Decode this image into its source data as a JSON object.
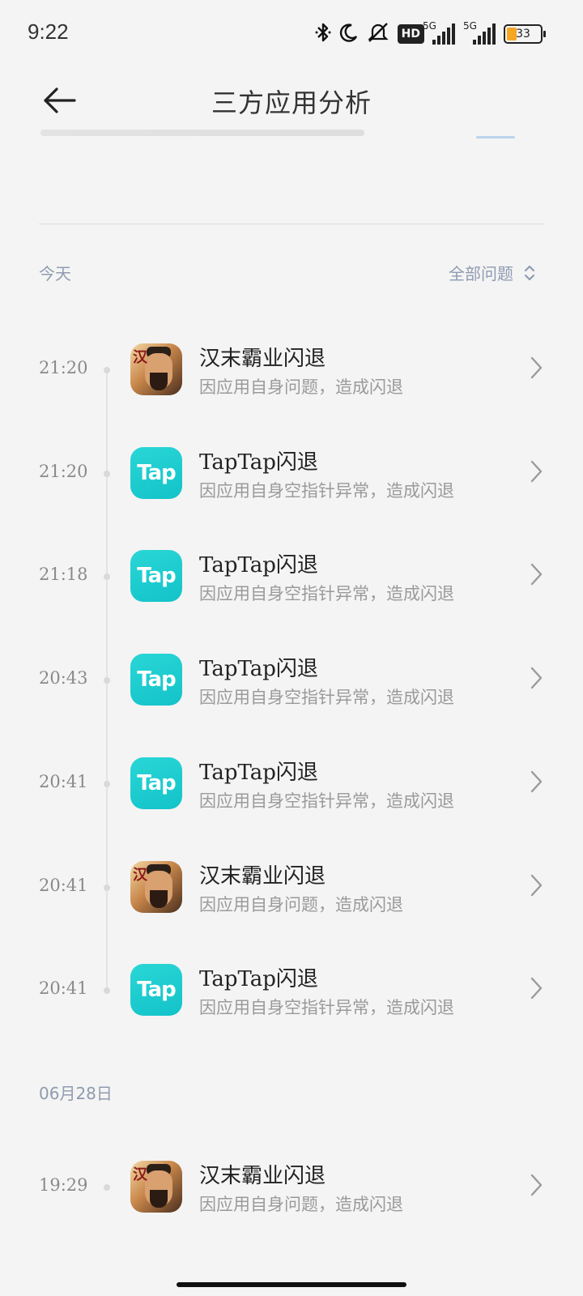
{
  "status_bar": {
    "time": "9:22",
    "icons": [
      "bluetooth-icon",
      "moon-icon",
      "mute-icon",
      "hd-icon",
      "signal-5g-icon",
      "signal-5g-icon",
      "battery-icon"
    ],
    "hd_label": "HD",
    "network_label_1": "5G",
    "network_label_2": "5G",
    "battery_percent": "33"
  },
  "header": {
    "title": "三方应用分析",
    "back_icon": "arrow-left-icon"
  },
  "sections": [
    {
      "label": "今天",
      "filter_label": "全部问题",
      "items": [
        {
          "time": "21:20",
          "app": "han",
          "name": "汉末霸业闪退",
          "desc": "因应用自身问题，造成闪退"
        },
        {
          "time": "21:20",
          "app": "tap",
          "name": "TapTap闪退",
          "desc": "因应用自身空指针异常，造成闪退"
        },
        {
          "time": "21:18",
          "app": "tap",
          "name": "TapTap闪退",
          "desc": "因应用自身空指针异常，造成闪退"
        },
        {
          "time": "20:43",
          "app": "tap",
          "name": "TapTap闪退",
          "desc": "因应用自身空指针异常，造成闪退"
        },
        {
          "time": "20:41",
          "app": "tap",
          "name": "TapTap闪退",
          "desc": "因应用自身空指针异常，造成闪退"
        },
        {
          "time": "20:41",
          "app": "han",
          "name": "汉末霸业闪退",
          "desc": "因应用自身问题，造成闪退"
        },
        {
          "time": "20:41",
          "app": "tap",
          "name": "TapTap闪退",
          "desc": "因应用自身空指针异常，造成闪退"
        }
      ]
    },
    {
      "label": "06月28日",
      "items": [
        {
          "time": "19:29",
          "app": "han",
          "name": "汉末霸业闪退",
          "desc": "因应用自身问题，造成闪退"
        }
      ]
    }
  ],
  "icon_text": {
    "tap": "Tap",
    "han": "汉"
  },
  "colors": {
    "tap_accent": "#12c3c9",
    "muted": "#8f9bb0",
    "background": "#f4f4f4"
  }
}
